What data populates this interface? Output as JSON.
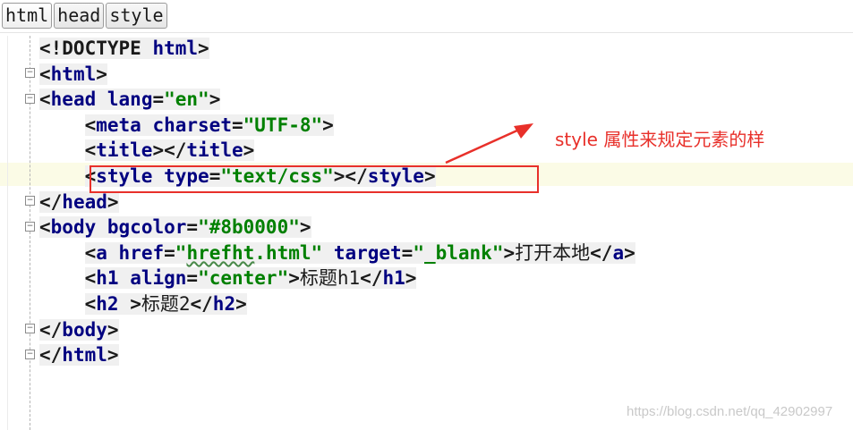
{
  "tabs": [
    {
      "label": "html",
      "active": true
    },
    {
      "label": "head",
      "active": false
    },
    {
      "label": "style",
      "active": false
    }
  ],
  "code": {
    "doctype": "<!DOCTYPE ",
    "doctype_kw": "html",
    "doctype_end": ">",
    "html_open": "html",
    "head_open": "head",
    "lang_attr": "lang",
    "lang_val": "\"en\"",
    "meta_tag": "meta",
    "charset_attr": "charset",
    "charset_val": "\"UTF-8\"",
    "title_tag": "title",
    "style_tag": "style",
    "type_attr": "type",
    "type_val": "\"text/css\"",
    "head_close": "head",
    "body_open": "body",
    "bgcolor_attr": "bgcolor",
    "bgcolor_val": "\"#8b0000\"",
    "a_tag": "a",
    "href_attr": "href",
    "href_val_pre": "\"",
    "href_val_u": "hrefht",
    "href_val_post": ".html\"",
    "target_attr": "target",
    "target_val": "\"_blank\"",
    "a_text": "打开本地",
    "h1_tag": "h1",
    "align_attr": "align",
    "align_val": "\"center\"",
    "h1_text": "标题h1",
    "h2_tag": "h2",
    "h2_text": "标题2",
    "body_close": "body",
    "html_close": "html"
  },
  "annotation": {
    "text": "style 属性来规定元素的样",
    "color": "#e8302a"
  },
  "watermark": "https://blog.csdn.net/qq_42902997"
}
